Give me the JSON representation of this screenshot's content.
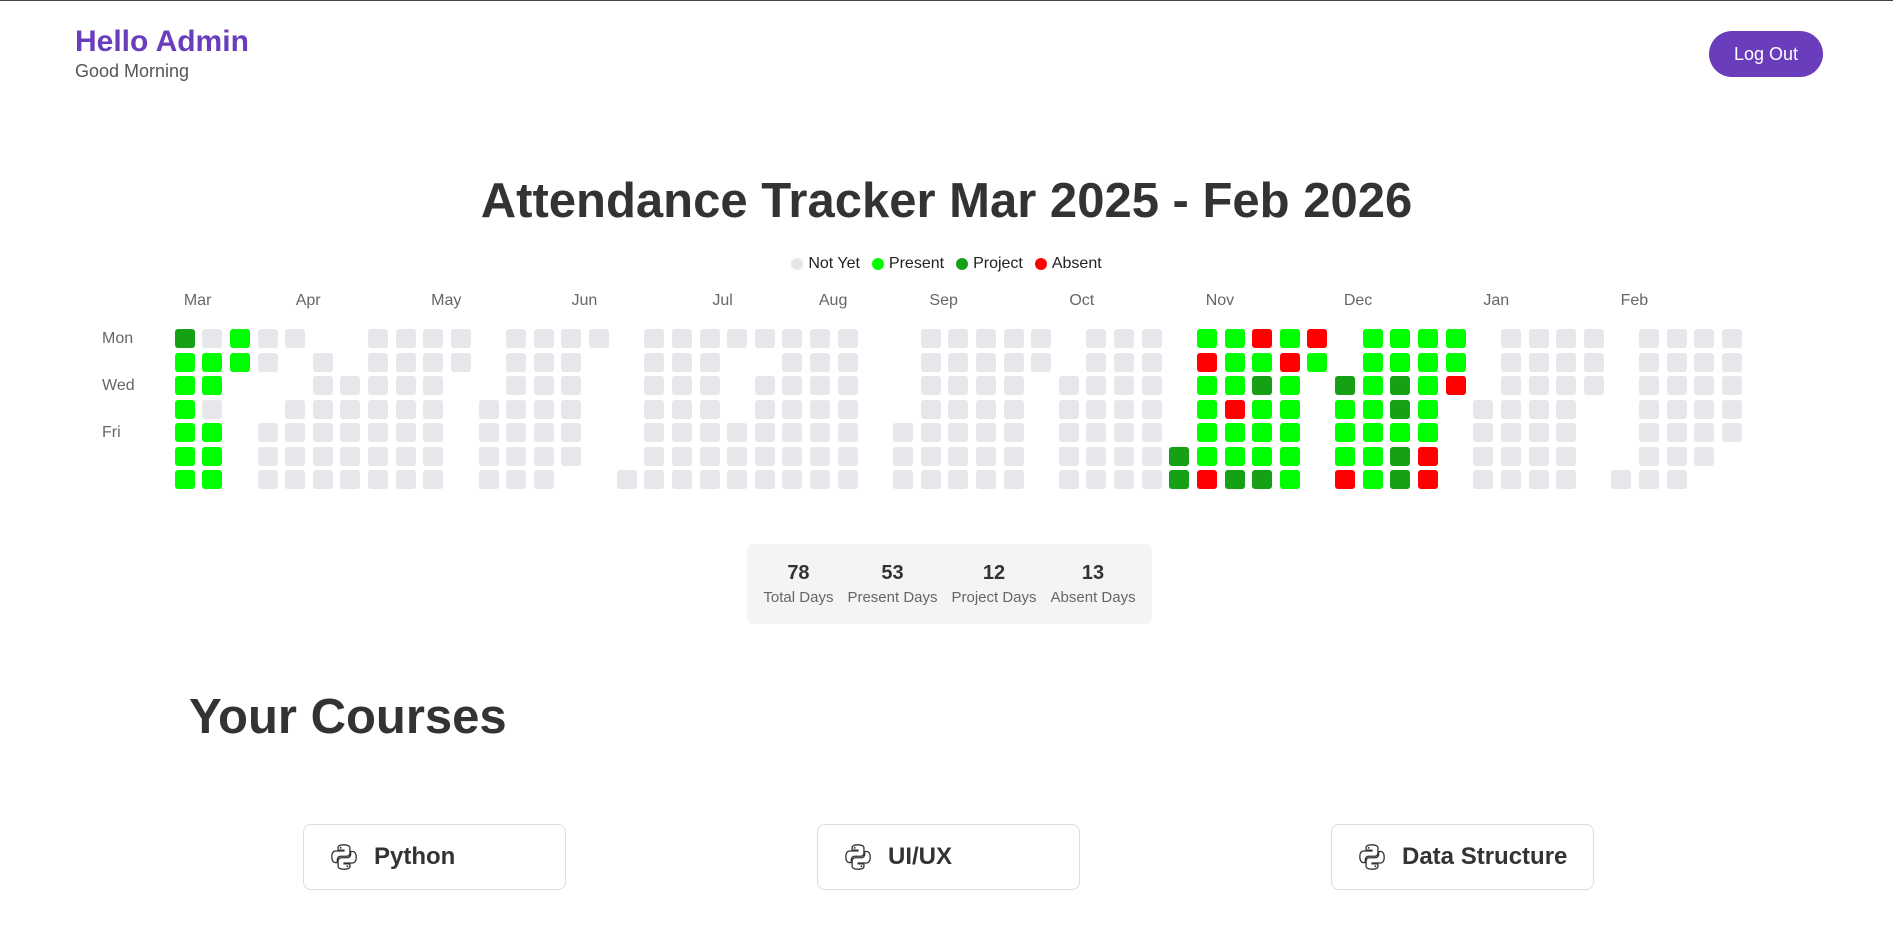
{
  "header": {
    "greeting": "Hello Admin",
    "subgreeting": "Good Morning",
    "logout_label": "Log Out"
  },
  "tracker": {
    "title": "Attendance Tracker Mar 2025 - Feb 2026",
    "legend": [
      {
        "label": "Not Yet",
        "color": "#e5e7eb"
      },
      {
        "label": "Present",
        "color": "#00ff00"
      },
      {
        "label": "Project",
        "color": "#16a016"
      },
      {
        "label": "Absent",
        "color": "#ff0000"
      }
    ],
    "months": [
      "Mar",
      "Apr",
      "May",
      "Jun",
      "Jul",
      "Aug",
      "Sep",
      "Oct",
      "Nov",
      "Dec",
      "Jan",
      "Feb"
    ],
    "day_labels": [
      "Mon",
      "Wed",
      "Fri"
    ],
    "weeks": [
      "       ",
      "JPPPPPP",
      "NPPNPPP",
      "PP     ",
      "NN  NNN",
      "N  NNNN",
      " NNNNNN",
      "  NNNNN",
      "NNNNNNN",
      "NNNNNNN",
      "NNNNNNN",
      "NN     ",
      "   NNNN",
      "NNNNNNN",
      "NNNNNNN",
      "NNNNNN ",
      "N      ",
      "      N",
      "NNNNNNN",
      "NNNNNNN",
      "NNNNNNN",
      "N   NNN",
      "N NNNNN",
      "NNNNNNN",
      "NNNNNNN",
      "NNNNNNN",
      "       ",
      "    NNN",
      "NNNNNNN",
      "NNNNNNN",
      "NNNNNNN",
      "NNNNNNN",
      "NN     ",
      "  NNNNN",
      "NNNNNNN",
      "NNNNNNN",
      "NNNNNNN",
      "     JJ",
      "PAPPPPA",
      "PPPAPPJ",
      "APJPPPJ",
      "PAPPPPP",
      "AP     ",
      "  JPPPA",
      "PPPPPPP",
      "PPJJPJJ",
      "PPPPPAA",
      "PPA    ",
      "   NNNN",
      "NNNNNNN",
      "NNNNNNN",
      "NNNNNNN",
      "NNN    ",
      "      N",
      "NNNNNNN",
      "NNNNNNN",
      "NNNNNN ",
      "NNNNN  "
    ]
  },
  "stats": [
    {
      "value": "78",
      "label": "Total Days"
    },
    {
      "value": "53",
      "label": "Present Days"
    },
    {
      "value": "12",
      "label": "Project Days"
    },
    {
      "value": "13",
      "label": "Absent Days"
    }
  ],
  "courses": {
    "title": "Your Courses",
    "items": [
      {
        "name": "Python",
        "icon": "python-icon"
      },
      {
        "name": "UI/UX",
        "icon": "python-icon"
      },
      {
        "name": "Data Structure",
        "icon": "python-icon"
      }
    ]
  }
}
